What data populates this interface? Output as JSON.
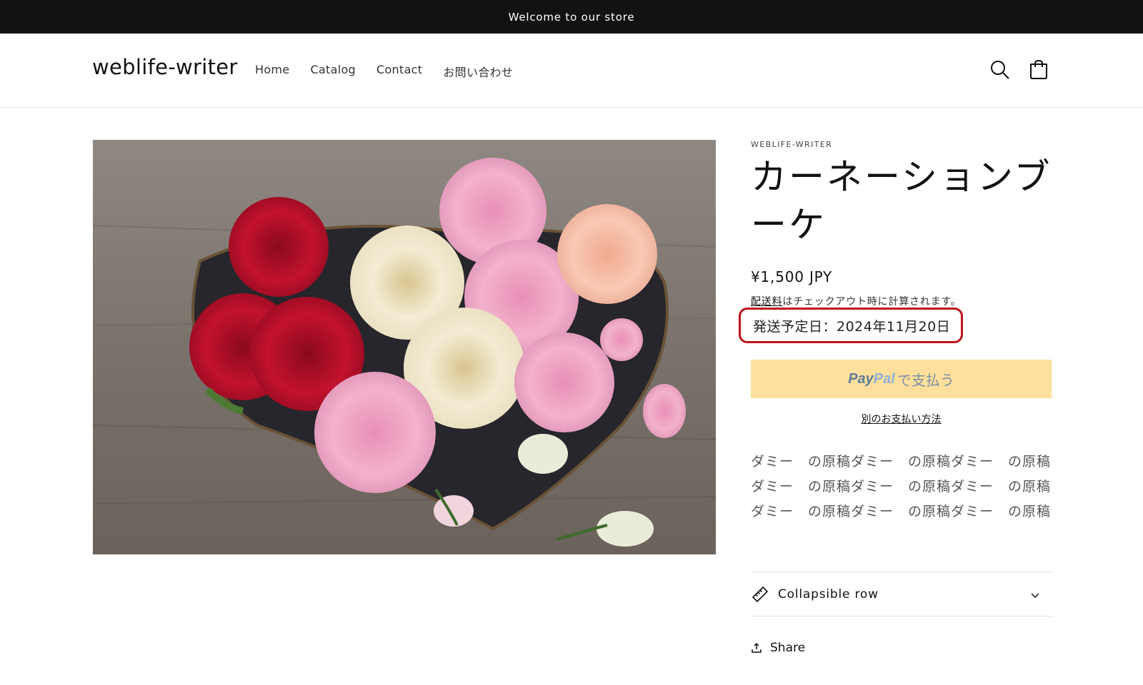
{
  "announcement": {
    "text": "Welcome to our store"
  },
  "header": {
    "logo": "weblife-writer",
    "nav": [
      {
        "label": "Home"
      },
      {
        "label": "Catalog"
      },
      {
        "label": "Contact"
      },
      {
        "label": "お問い合わせ"
      }
    ],
    "icons": {
      "search": "search-icon",
      "cart": "cart-icon"
    }
  },
  "product": {
    "image_alt": "carnation bouquet on heart-shaped board",
    "vendor": "WEBLIFE-WRITER",
    "title": "カーネーションブーケ",
    "price": "¥1,500 JPY",
    "shipping_link": "配送料",
    "shipping_text": "はチェックアウト時に計算されます。",
    "ship_date": "発送予定日：2024年11月20日",
    "paypal": {
      "pay": "Pay",
      "pal": "Pal",
      "suffix": "で支払う"
    },
    "more_payment": "別のお支払い方法",
    "description": "ダミー　の原稿ダミー　の原稿ダミー　の原稿ダミー　の原稿ダミー　の原稿ダミー　の原稿ダミー　の原稿ダミー　の原稿ダミー　の原稿",
    "collapsible": {
      "label": "Collapsible row",
      "icon": "ruler-icon"
    },
    "share": "Share"
  },
  "colors": {
    "announcement_bg": "#121212",
    "highlight_border": "#c0141b",
    "paypal_bg": "#fedf9b"
  }
}
